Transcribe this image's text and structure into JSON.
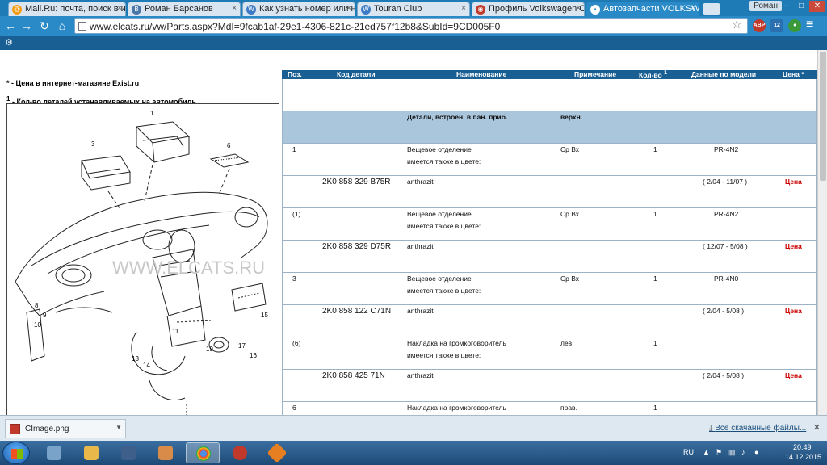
{
  "browser": {
    "tabs": [
      {
        "title": "Mail.Ru: почта, поиск в и"
      },
      {
        "title": "Роман Барсанов"
      },
      {
        "title": "Как узнать номер или на"
      },
      {
        "title": "Touran Club"
      },
      {
        "title": "Профиль Volkswagen Ca"
      },
      {
        "title": "Автозапчасти VOLKSWA"
      }
    ],
    "profile_name": "Роман",
    "url": "www.elcats.ru/vw/Parts.aspx?MdI=9fcab1af-29e1-4306-821c-21ed757f12b8&SubId=9CD005F0",
    "extensions": [
      "ABP",
      "12"
    ]
  },
  "notes": {
    "price_star": "*",
    "price_note": " - Цена в интернет-магазине Exist.ru",
    "qty_mark": "1",
    "qty_note": " - Кол-во деталей устанавливаемых на автомобиль."
  },
  "diagram": {
    "watermark": "WWW.ELCATS.RU",
    "callouts": [
      "1",
      "3",
      "6",
      "8",
      "9",
      "10",
      "11",
      "13",
      "14",
      "15",
      "16",
      "17",
      "19"
    ]
  },
  "table": {
    "headers": {
      "pos": "Поз.",
      "code": "Код детали",
      "name": "Наименование",
      "note": "Примечание",
      "qty": "Кол-во",
      "qty_sup": "1",
      "model": "Данные по модели",
      "price": "Цена *"
    },
    "group": {
      "name": "Детали, встроен. в пан. приб.",
      "note": "верхн."
    },
    "rows": [
      {
        "type": "item",
        "pos": "1",
        "name": "Вещевое отделение",
        "name2": "имеется также в цвете:",
        "note": "Ср Вх",
        "qty": "1",
        "model": "PR-4N2"
      },
      {
        "type": "part",
        "code": "2K0 858 329 B75R",
        "name": "anthrazit",
        "model": "( 2/04 - 11/07 )",
        "price": "Цена"
      },
      {
        "type": "item",
        "pos": "(1)",
        "name": "Вещевое отделение",
        "name2": "имеется также в цвете:",
        "note": "Ср Вх",
        "qty": "1",
        "model": "PR-4N2"
      },
      {
        "type": "part",
        "code": "2K0 858 329 D75R",
        "name": "anthrazit",
        "model": "( 12/07 - 5/08 )",
        "price": "Цена"
      },
      {
        "type": "item",
        "pos": "3",
        "name": "Вещевое отделение",
        "name2": "имеется также в цвете:",
        "note": "Ср Вх",
        "qty": "1",
        "model": "PR-4N0"
      },
      {
        "type": "part",
        "code": "2K0 858 122 C71N",
        "name": "anthrazit",
        "model": "( 2/04 - 5/08 )",
        "price": "Цена"
      },
      {
        "type": "item",
        "pos": "(6)",
        "name": "Накладка на громкоговоритель",
        "name2": "имеется также в цвете:",
        "note": "лев.",
        "qty": "1",
        "model": ""
      },
      {
        "type": "part",
        "code": "2K0 858 425 71N",
        "name": "anthrazit",
        "model": "( 2/04 - 5/08 )",
        "price": "Цена"
      },
      {
        "type": "item",
        "pos": "6",
        "name": "Накладка на громкоговоритель",
        "name2": "",
        "note": "прав.",
        "qty": "1",
        "model": ""
      }
    ]
  },
  "downloads": {
    "file": "CImage.png",
    "show_all": "Все скачанные файлы..."
  },
  "taskbar": {
    "lang": "RU",
    "time": "20:49",
    "date": "14.12.2015"
  }
}
